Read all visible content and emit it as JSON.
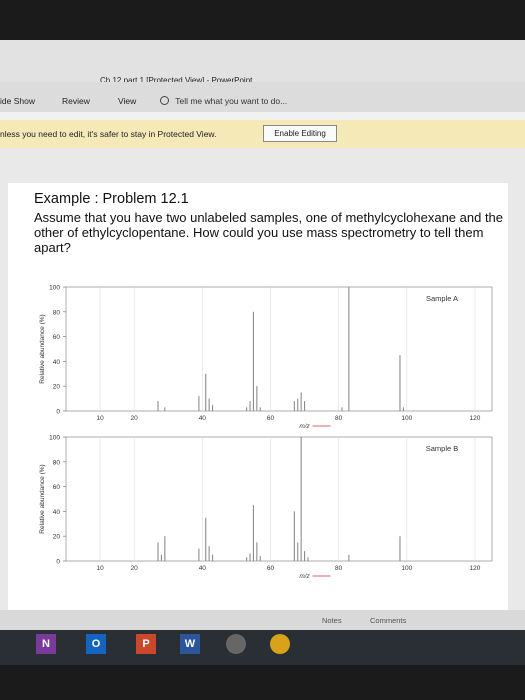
{
  "window": {
    "title": "Ch 12 part 1 [Protected View] - PowerPoint"
  },
  "ribbon": {
    "tabs": [
      "ide Show",
      "Review",
      "View"
    ],
    "tell_me": "Tell me what you want to do..."
  },
  "protected_bar": {
    "message": "nless you need to edit, it's safer to stay in Protected View.",
    "button_label": "Enable Editing"
  },
  "slide": {
    "heading": "Example : Problem 12.1",
    "body": "Assume that you have two unlabeled samples, one of methylcyclohexane and the other of ethylcyclopentane. How could you use mass spectrometry to tell them apart?"
  },
  "chart_data": [
    {
      "type": "bar",
      "title": "Sample A",
      "xlabel": "m/z",
      "ylabel": "Relative abundance (%)",
      "xlim": [
        0,
        125
      ],
      "ylim": [
        0,
        100
      ],
      "xticks": [
        10,
        20,
        40,
        60,
        80,
        100,
        120
      ],
      "yticks": [
        0,
        20,
        40,
        60,
        80,
        100
      ],
      "x": [
        27,
        29,
        39,
        41,
        42,
        43,
        53,
        54,
        55,
        56,
        57,
        67,
        68,
        69,
        70,
        81,
        83,
        98,
        99
      ],
      "values": [
        8,
        3,
        12,
        30,
        10,
        5,
        3,
        8,
        80,
        20,
        3,
        8,
        10,
        15,
        8,
        3,
        100,
        45,
        3
      ]
    },
    {
      "type": "bar",
      "title": "Sample B",
      "xlabel": "m/z",
      "ylabel": "Relative abundance (%)",
      "xlim": [
        0,
        125
      ],
      "ylim": [
        0,
        100
      ],
      "xticks": [
        10,
        20,
        40,
        60,
        80,
        100,
        120
      ],
      "yticks": [
        0,
        20,
        40,
        60,
        80,
        100
      ],
      "x": [
        27,
        28,
        29,
        39,
        41,
        42,
        43,
        53,
        54,
        55,
        56,
        57,
        67,
        68,
        69,
        70,
        71,
        83,
        98
      ],
      "values": [
        15,
        5,
        20,
        10,
        35,
        12,
        5,
        3,
        6,
        45,
        15,
        4,
        40,
        15,
        100,
        8,
        3,
        5,
        20
      ]
    }
  ],
  "status": {
    "notes": "Notes",
    "comments": "Comments"
  },
  "taskbar": {
    "onenote": "N",
    "outlook": "O",
    "powerpoint": "P",
    "word": "W"
  }
}
